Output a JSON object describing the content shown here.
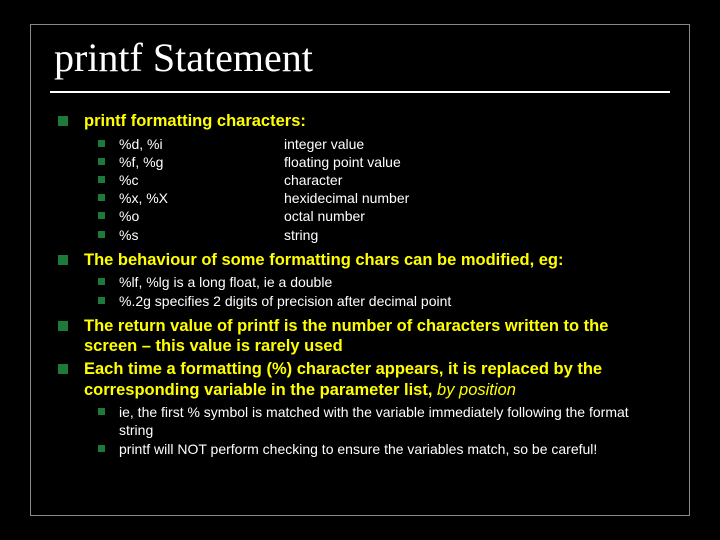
{
  "title": "printf Statement",
  "section1": {
    "heading": "printf formatting characters:",
    "rows": [
      {
        "l": "%d, %i",
        "r": "integer value"
      },
      {
        "l": "%f, %g",
        "r": "floating point value"
      },
      {
        "l": "%c",
        "r": "character"
      },
      {
        "l": "%x, %X",
        "r": "hexidecimal number"
      },
      {
        "l": "%o",
        "r": "octal number"
      },
      {
        "l": "%s",
        "r": "string"
      }
    ]
  },
  "section2": {
    "heading": "The behaviour of some formatting chars can be modified, eg:",
    "items": [
      "%lf, %lg is a long float, ie a double",
      "%.2g specifies 2 digits of precision after decimal point"
    ]
  },
  "section3": {
    "heading": "The return value of printf is the number of characters written to the screen – this value is rarely used"
  },
  "section4": {
    "heading_a": "Each time a formatting (%) character appears, it is replaced by the corresponding variable in the parameter list, ",
    "heading_b": "by position",
    "items": [
      "ie, the first % symbol is matched with the variable immediately following the format string",
      "printf will NOT perform checking to ensure the variables match, so be careful!"
    ]
  }
}
